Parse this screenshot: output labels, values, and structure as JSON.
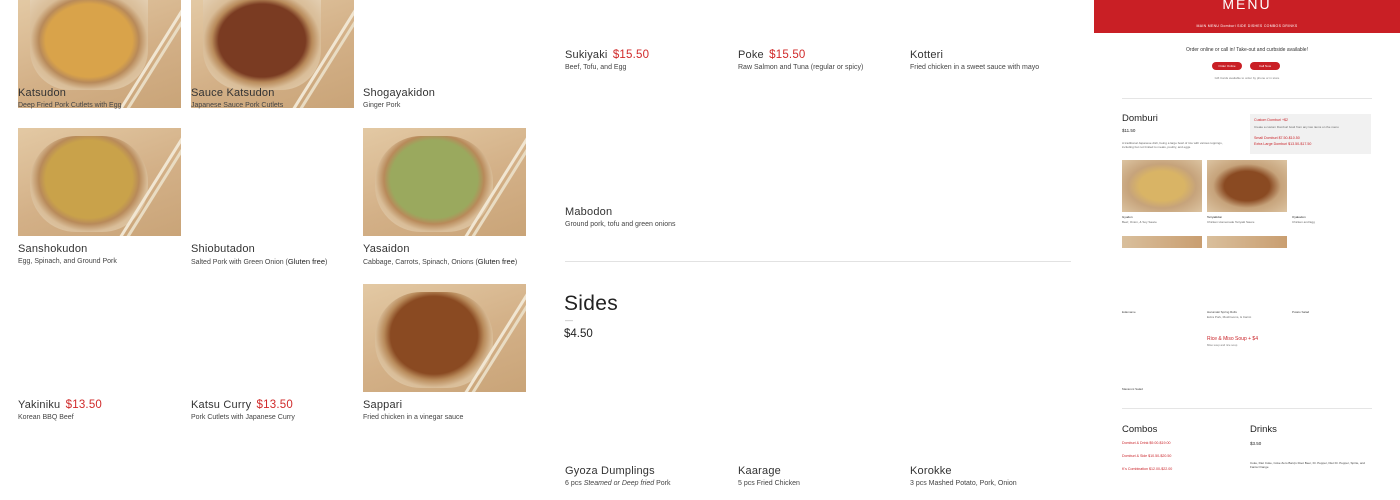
{
  "menu_items": [
    {
      "name": "Katsudon",
      "price": "",
      "desc": "Deep Fried Pork Cutlets with Egg",
      "food": "#d9a34a"
    },
    {
      "name": "Sauce Katsudon",
      "price": "",
      "desc": "Japanese Sauce Pork Cutlets",
      "food": "#7a3b22"
    },
    {
      "name": "Shogayakidon",
      "price": "",
      "desc": "Ginger Pork"
    },
    {
      "name": "Sanshokudon",
      "price": "",
      "desc": "Egg, Spinach, and Ground Pork",
      "food": "#c9a24a"
    },
    {
      "name": "Shiobutadon",
      "price": "",
      "desc_pre": "Salted Pork with Green Onion (",
      "desc_gf": "Gluten free",
      "desc_post": ")"
    },
    {
      "name": "Yasaidon",
      "price": "",
      "desc_pre": "Cabbage, Carrots, Spinach, Onions (",
      "desc_gf": "Gluten free",
      "desc_post": ")",
      "food": "#9aa95e"
    },
    {
      "name": "Yakiniku",
      "price": "$13.50",
      "desc": "Korean BBQ Beef"
    },
    {
      "name": "Katsu Curry",
      "price": "$13.50",
      "desc": "Pork Cutlets with Japanese Curry"
    },
    {
      "name": "Sappari",
      "price": "",
      "desc": "Fried chicken in a vinegar sauce",
      "food": "#8a4a22"
    },
    {
      "name": "Sukiyaki",
      "price": "$15.50",
      "desc": "Beef, Tofu, and Egg"
    },
    {
      "name": "Poke",
      "price": "$15.50",
      "desc": "Raw Salmon and Tuna (regular or spicy)"
    },
    {
      "name": "Kotteri",
      "price": "",
      "desc": "Fried chicken in a sweet sauce with mayo"
    },
    {
      "name": "Mabodon",
      "price": "",
      "desc": "Ground pork, tofu and green onions"
    }
  ],
  "sides": {
    "title": "Sides",
    "dash": "—",
    "price": "$4.50",
    "items": [
      {
        "name": "Gyoza Dumplings",
        "desc_pre": "6 pcs ",
        "desc_em": "Steamed or Deep fried",
        "desc_post": " Pork"
      },
      {
        "name": "Kaarage",
        "desc": "5 pcs Fried Chicken"
      },
      {
        "name": "Korokke",
        "desc": "3 pcs Mashed Potato, Pork, Onion"
      }
    ]
  },
  "preview": {
    "title": "MENU",
    "nav": "MAIN MENU  Domburi  SIDE DISHES  COMBOS  DRINKS",
    "order_text": "Order online or call in! Take-out and curbside available!",
    "btn1": "Order Online",
    "btn2": "Call Now",
    "gift": "Gift Cards available to order by phone or in store",
    "domburi_title": "Domburi",
    "domburi_price": "$11.50",
    "domburi_desc": "A traditional Japanese dish, being a large bowl of rice with various toppings, including but not limited to meats, poultry, and eggs.",
    "custom_title": "Custom Domburi +$2",
    "custom_desc": "Create a custom Domburi bowl from any two items on the menu",
    "small": "Small Domburi $7.50-$10.50",
    "xlarge": "Extra Large Domburi $13.50-$17.50",
    "gyudon": "Gyudon",
    "gyudon_d": "Beef, Onion, & Soy Sauce",
    "teriyaki": "Teriyakidon",
    "teriyaki_d": "Chicken Homemade Teriyaki Sauce",
    "oyako": "Oyakodon",
    "oyako_d": "Chicken and Egg",
    "edamame": "Edamame",
    "harumaki": "Harumaki Spring Rolls",
    "harumaki_d": "Extra Pork, Mushrooms, & Carrot",
    "potato": "Potato Salad",
    "rice": "Rice & Miso Soup + $4",
    "rice_d": "Miso soup and rice soup",
    "macaroni": "Macaroni Salad",
    "combos_title": "Combos",
    "combo1": "Domburi & Drink $9.00-$19.00",
    "combo2": "Domburi & Side $10.50-$20.50",
    "combo3": "K's Combination $12.00-$22.00",
    "drinks_title": "Drinks",
    "drinks_price": "$3.50",
    "drinks_list": "Coke, Diet Coke, Coke Zero Barq's Root Beer, Dr. Pepper, Diet Dr. Pepper, Sprite, and Fanta Orange"
  }
}
